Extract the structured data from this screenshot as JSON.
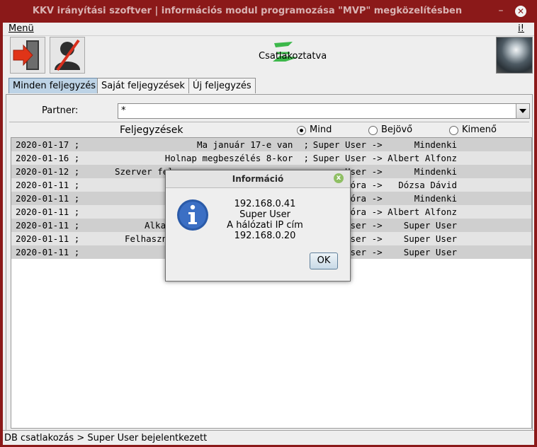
{
  "window": {
    "title": "KKV irányítási szoftver | információs modul programozása \"MVP\" megközelítésben",
    "minimize": "–",
    "close": "✕"
  },
  "menu": {
    "main": "Menü",
    "help": "i!"
  },
  "toolbar": {
    "status": "Csatlakoztatva"
  },
  "tabs": [
    "Minden feljegyzés",
    "Saját feljegyzések",
    "Új feljegyzés"
  ],
  "filter": {
    "label": "Partner:",
    "value": "*"
  },
  "list": {
    "title": "Feljegyzések",
    "radios": [
      "Mind",
      "Bejövő",
      "Kimenő"
    ],
    "selected_radio": "Mind",
    "rows": [
      {
        "date": "2020-01-17 ;",
        "text": "Ma január 17-e van  ;",
        "route": "Super User ->      Mindenki"
      },
      {
        "date": "2020-01-16 ;",
        "text": "Holnap megbeszélés 8-kor  ;",
        "route": "Super User -> Albert Alfonz"
      },
      {
        "date": "2020-01-12 ;",
        "text": "Szerver fel",
        "route": "User ->      Mindenki"
      },
      {
        "date": "2020-01-11 ;",
        "text": "",
        "route": "Dóra ->   Dózsa Dávid"
      },
      {
        "date": "2020-01-11 ;",
        "text": "",
        "route": "Dóra ->      Mindenki"
      },
      {
        "date": "2020-01-11 ;",
        "text": "",
        "route": "Dóra -> Albert Alfonz"
      },
      {
        "date": "2020-01-11 ;",
        "text": "Alkal",
        "route": "User ->    Super User"
      },
      {
        "date": "2020-01-11 ;",
        "text": "Felhaszná",
        "route": "User ->    Super User"
      },
      {
        "date": "2020-01-11 ;",
        "text": "",
        "route": "User ->    Super User"
      }
    ]
  },
  "statusbar": {
    "text": "DB csatlakozás > Super User bejelentkezett"
  },
  "dialog": {
    "title": "Információ",
    "close": "x",
    "lines": [
      "192.168.0.41",
      "Super User",
      "A hálózati IP cím",
      "192.168.0.20"
    ],
    "ok": "OK"
  }
}
